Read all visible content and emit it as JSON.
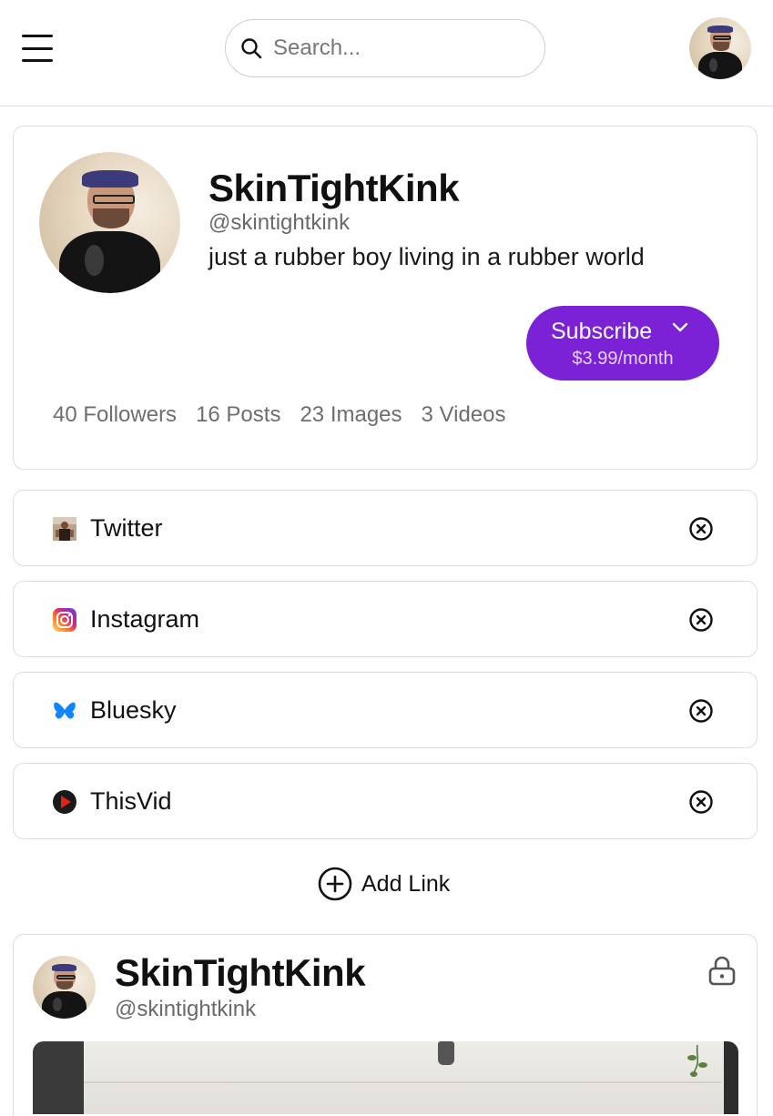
{
  "header": {
    "search_placeholder": "Search..."
  },
  "profile": {
    "display_name": "SkinTightKink",
    "handle": "@skintightkink",
    "bio": "just a rubber boy living in a rubber world",
    "subscribe": {
      "label": "Subscribe",
      "price": "$3.99/month"
    },
    "stats": {
      "followers": "40 Followers",
      "posts": "16 Posts",
      "images": "23 Images",
      "videos": "3 Videos"
    }
  },
  "links": [
    {
      "label": "Twitter",
      "icon": "twitter-avatar-icon"
    },
    {
      "label": "Instagram",
      "icon": "instagram-icon"
    },
    {
      "label": "Bluesky",
      "icon": "bluesky-butterfly-icon"
    },
    {
      "label": "ThisVid",
      "icon": "thisvid-play-icon"
    }
  ],
  "add_link": {
    "label": "Add Link"
  },
  "post": {
    "display_name": "SkinTightKink",
    "handle": "@skintightkink"
  },
  "colors": {
    "accent": "#7b22d6",
    "bluesky": "#1185fe",
    "thisvid": "#e0241a"
  }
}
